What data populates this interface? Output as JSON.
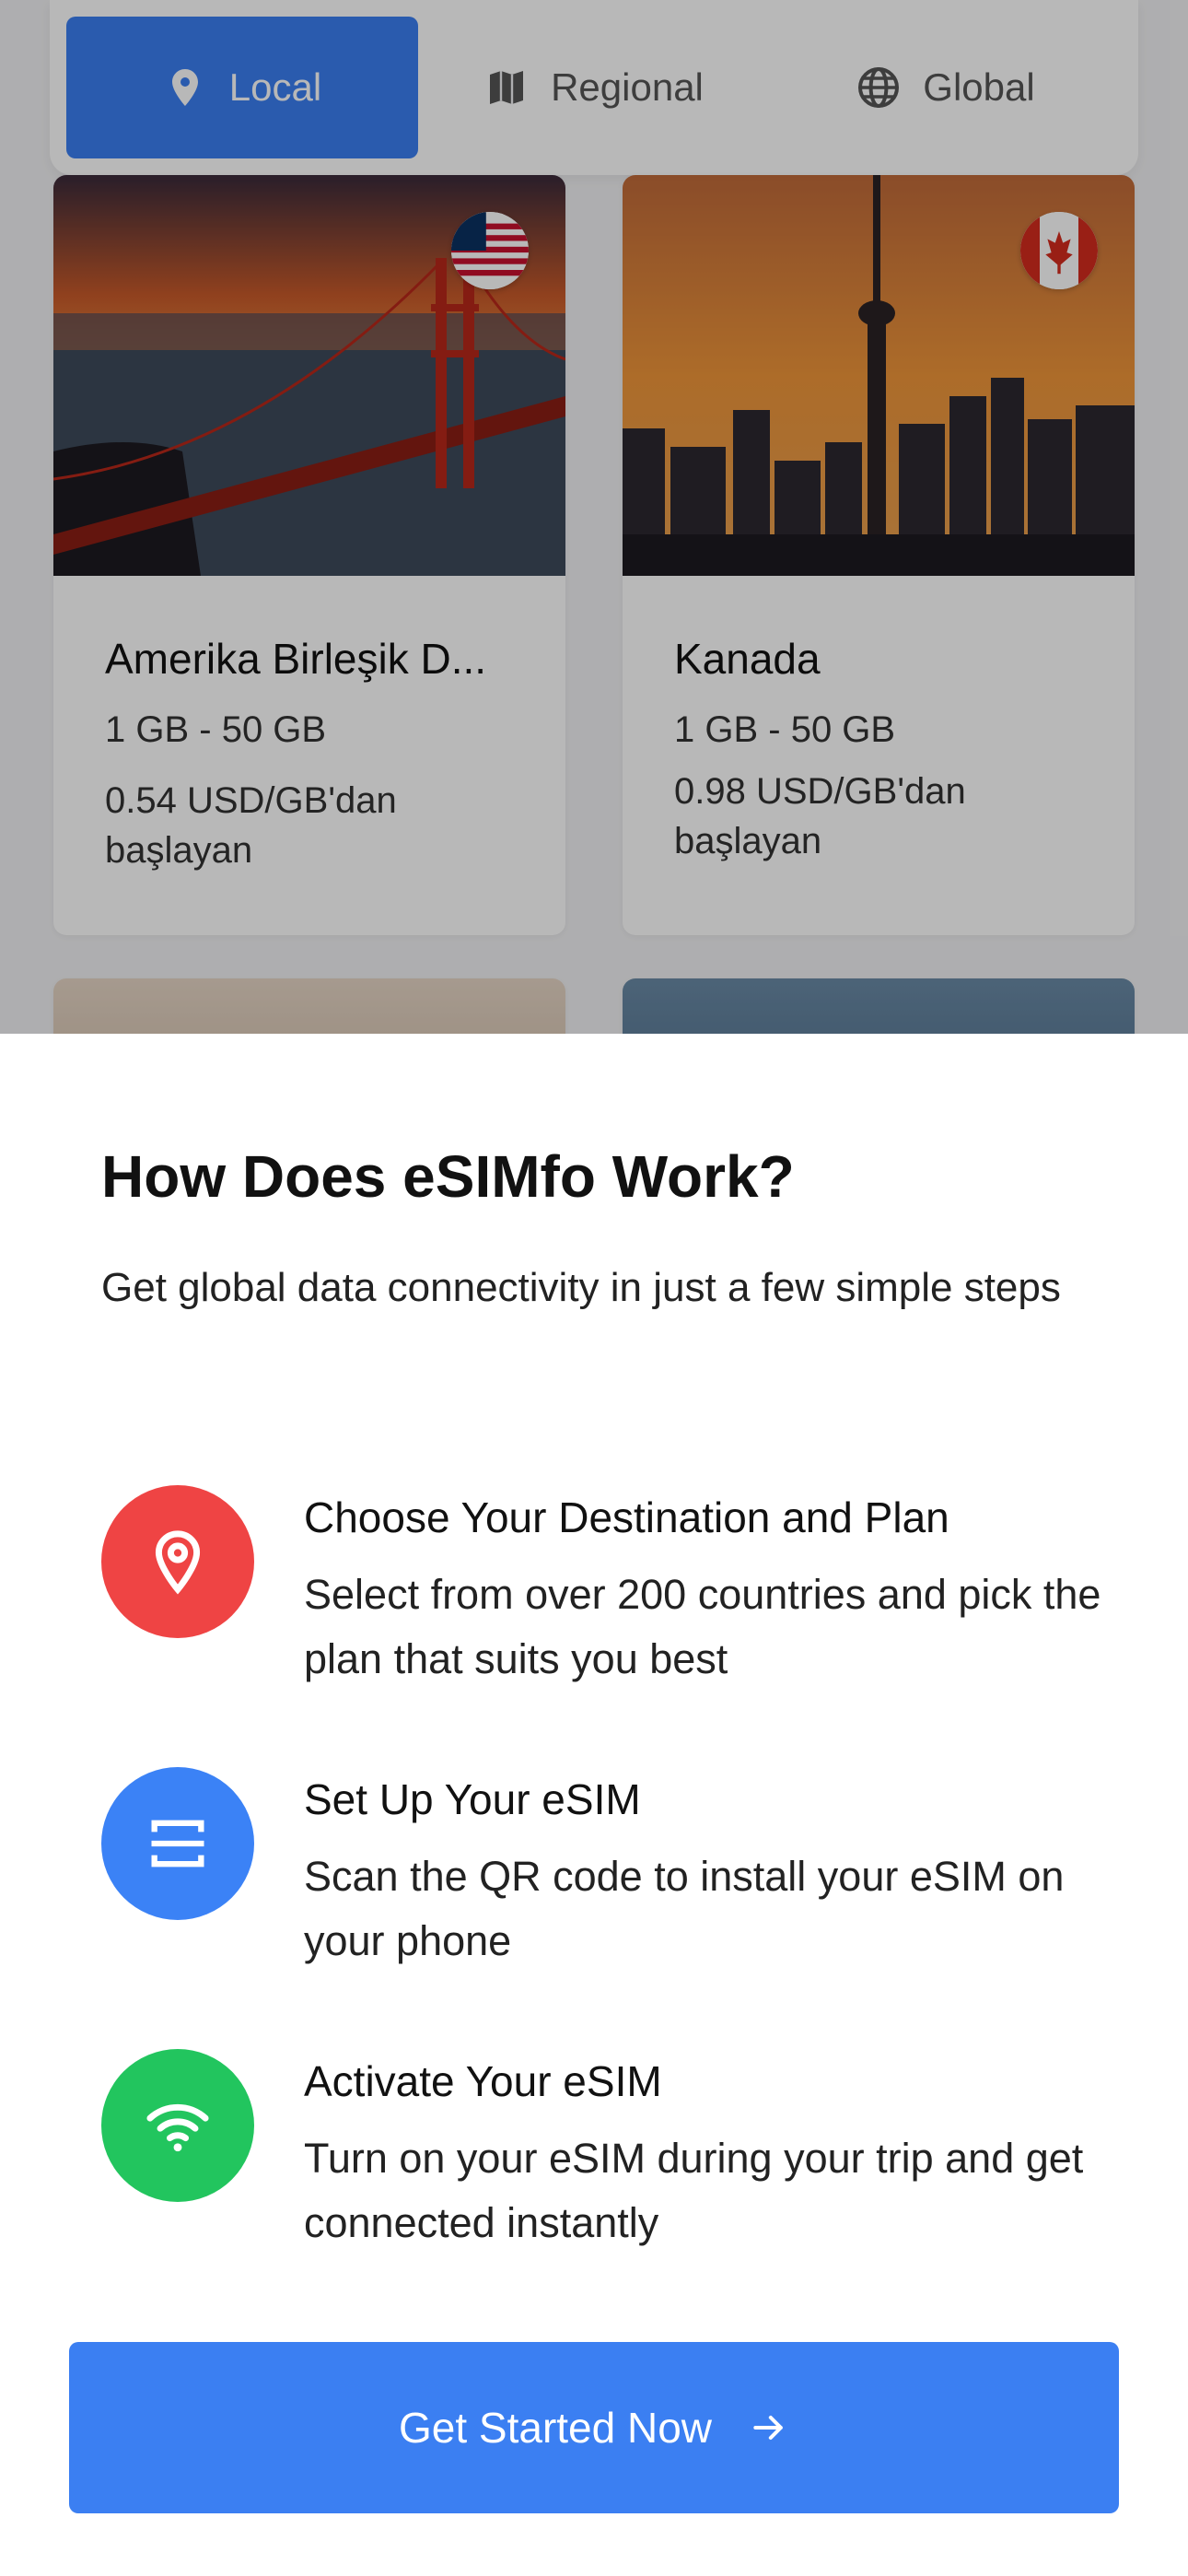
{
  "tabs": [
    {
      "label": "Local",
      "icon": "location-pin-icon",
      "active": true
    },
    {
      "label": "Regional",
      "icon": "map-icon",
      "active": false
    },
    {
      "label": "Global",
      "icon": "globe-icon",
      "active": false
    }
  ],
  "cards": [
    {
      "country": "Amerika Birleşik D...",
      "range": "1 GB - 50 GB",
      "price": "0.54 USD/GB'dan başlayan",
      "flag": "us-flag-icon"
    },
    {
      "country": "Kanada",
      "range": "1 GB - 50 GB",
      "price": "0.98 USD/GB'dan başlayan",
      "flag": "canada-flag-icon"
    }
  ],
  "sheet": {
    "title": "How Does eSIMfo Work?",
    "subtitle": "Get global data connectivity in just a few simple steps",
    "steps": [
      {
        "title": "Choose Your Destination and Plan",
        "description": "Select from over 200 countries and pick the plan that suits you best",
        "icon": "location-pin-icon",
        "color": "#ef4444"
      },
      {
        "title": "Set Up Your eSIM",
        "description": "Scan the QR code to install your eSIM on your phone",
        "icon": "scan-icon",
        "color": "#3b82f6"
      },
      {
        "title": "Activate Your eSIM",
        "description": "Turn on your eSIM during your trip and get connected instantly",
        "icon": "wifi-icon",
        "color": "#22c55e"
      }
    ],
    "cta_label": "Get Started Now"
  },
  "colors": {
    "accent": "#3b7ff2",
    "red": "#ef4444",
    "blue": "#3b82f6",
    "green": "#22c55e"
  }
}
